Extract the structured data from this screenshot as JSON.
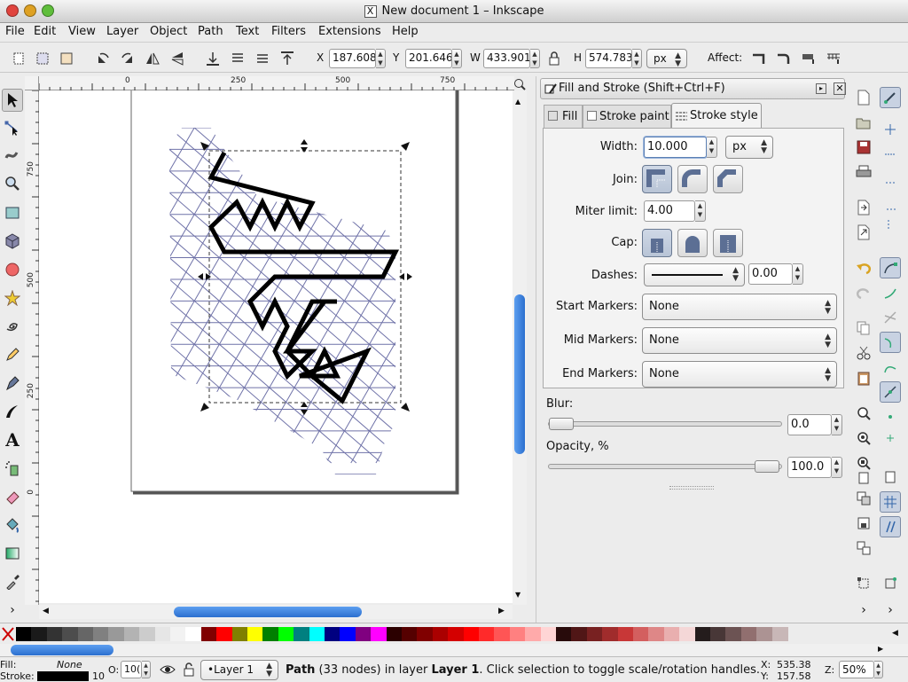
{
  "window": {
    "title": "New document 1 – Inkscape",
    "title_glyph": "X"
  },
  "menubar": {
    "items": [
      "File",
      "Edit",
      "View",
      "Layer",
      "Object",
      "Path",
      "Text",
      "Filters",
      "Extensions",
      "Help"
    ]
  },
  "toolbar": {
    "x_label": "X",
    "x_value": "187.608",
    "y_label": "Y",
    "y_value": "201.646",
    "w_label": "W",
    "w_value": "433.901",
    "h_label": "H",
    "h_value": "574.783",
    "unit": "px",
    "affect_label": "Affect:"
  },
  "ruler": {
    "h_ticks": [
      "0",
      "250",
      "500",
      "750"
    ],
    "v_ticks": [
      "750",
      "500",
      "250",
      "0"
    ]
  },
  "dock": {
    "title": "Fill and Stroke (Shift+Ctrl+F)",
    "tabs": [
      "Fill",
      "Stroke paint",
      "Stroke style"
    ],
    "active_tab": "Stroke style",
    "width_label": "Width:",
    "width_value": "10.000",
    "width_unit": "px",
    "join_label": "Join:",
    "miter_label": "Miter limit:",
    "miter_value": "4.00",
    "cap_label": "Cap:",
    "dashes_label": "Dashes:",
    "dash_offset": "0.00",
    "start_markers_label": "Start Markers:",
    "start_markers_value": "None",
    "mid_markers_label": "Mid Markers:",
    "mid_markers_value": "None",
    "end_markers_label": "End Markers:",
    "end_markers_value": "None",
    "blur_label": "Blur:",
    "blur_value": "0.0",
    "opacity_label": "Opacity, %",
    "opacity_value": "100.0"
  },
  "statusbar": {
    "fill_label": "Fill:",
    "fill_value": "None",
    "stroke_label": "Stroke:",
    "stroke_width": "10",
    "opacity_label": "O:",
    "opacity_value": "10(",
    "layer": "•Layer 1",
    "message_bold": "Path",
    "message": " (33 nodes) in layer ",
    "message_layer": "Layer 1",
    "message_tail": ". Click selection to toggle scale/rotation handles.",
    "x_label": "X:",
    "x_value": "535.38",
    "y_label": "Y:",
    "y_value": "157.58",
    "zoom_label": "Z:",
    "zoom_value": "50%"
  },
  "colors": {
    "grid": "#6f72a8",
    "path": "#000000",
    "scroll_blue": "#3f86e0",
    "palette": [
      "#000000",
      "#1a1a1a",
      "#333333",
      "#4d4d4d",
      "#666666",
      "#808080",
      "#999999",
      "#b3b3b3",
      "#cccccc",
      "#e6e6e6",
      "#f2f2f2",
      "#ffffff",
      "#800000",
      "#ff0000",
      "#808000",
      "#ffff00",
      "#008000",
      "#00ff00",
      "#008080",
      "#00ffff",
      "#000080",
      "#0000ff",
      "#800080",
      "#ff00ff",
      "#2b0000",
      "#550000",
      "#800000",
      "#aa0000",
      "#d40000",
      "#ff0000",
      "#ff2a2a",
      "#ff5555",
      "#ff8080",
      "#ffaaaa",
      "#ffd5d5",
      "#280b0b",
      "#501616",
      "#782121",
      "#a02c2c",
      "#c83737",
      "#d35f5f",
      "#de8787",
      "#e9afaf",
      "#f4d7d7",
      "#241c1c",
      "#483737",
      "#6c5353",
      "#916f6f",
      "#ac9393",
      "#c8b7b7"
    ]
  }
}
